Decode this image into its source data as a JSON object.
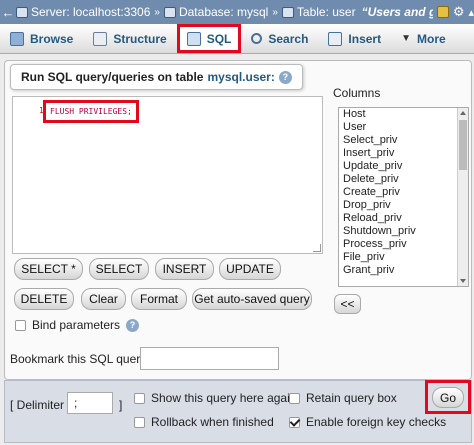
{
  "breadcrumb": {
    "server": "Server: localhost:3306",
    "database": "Database: mysql",
    "table": "Table: user",
    "title": "“Users and gl"
  },
  "tabs": [
    {
      "label": "Browse",
      "icon": "browse-icon"
    },
    {
      "label": "Structure",
      "icon": "structure-icon"
    },
    {
      "label": "SQL",
      "icon": "sql-icon"
    },
    {
      "label": "Search",
      "icon": "search-icon"
    },
    {
      "label": "Insert",
      "icon": "insert-icon"
    },
    {
      "label": "More",
      "icon": "chevron-down-icon"
    }
  ],
  "query_panel": {
    "legend_prefix": "Run SQL query/queries on table",
    "legend_table": "mysql.user:",
    "line_number": "1",
    "query": "FLUSH PRIVILEGES;"
  },
  "buttons": {
    "select_star": "SELECT *",
    "select": "SELECT",
    "insert": "INSERT",
    "update": "UPDATE",
    "delete": "DELETE",
    "clear": "Clear",
    "format": "Format",
    "autosave": "Get auto-saved query",
    "insert_col": "<<",
    "go": "Go"
  },
  "columns": {
    "label": "Columns",
    "items": [
      "Host",
      "User",
      "Select_priv",
      "Insert_priv",
      "Update_priv",
      "Delete_priv",
      "Create_priv",
      "Drop_priv",
      "Reload_priv",
      "Shutdown_priv",
      "Process_priv",
      "File_priv",
      "Grant_priv"
    ]
  },
  "bind_parameters": {
    "label": "Bind parameters",
    "checked": false
  },
  "bookmark": {
    "label": "Bookmark this SQL query:",
    "value": ""
  },
  "footer": {
    "delimiter_open": "[ Delimiter",
    "delimiter_value": ";",
    "delimiter_close": "]",
    "options": [
      {
        "label": "Show this query here again",
        "checked": false
      },
      {
        "label": "Retain query box",
        "checked": false
      },
      {
        "label": "Rollback when finished",
        "checked": false
      },
      {
        "label": "Enable foreign key checks",
        "checked": true
      }
    ]
  },
  "colors": {
    "header": "#6f8caf",
    "highlight": "#e0091d",
    "link": "#235a81"
  }
}
